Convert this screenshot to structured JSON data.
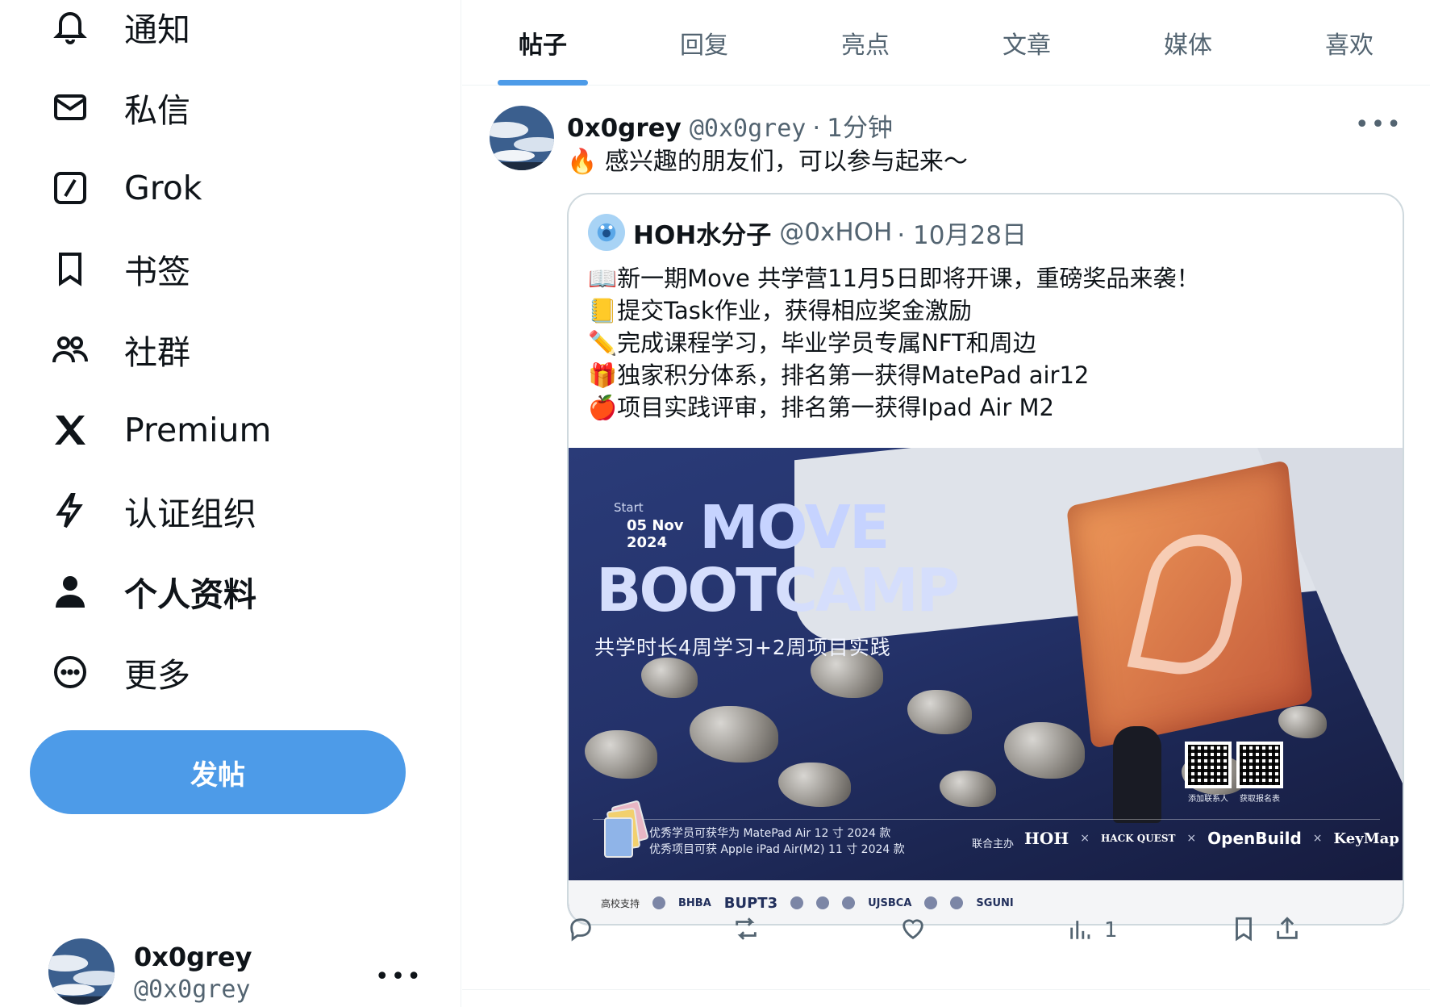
{
  "sidebar": {
    "items": [
      {
        "label": "通知",
        "icon": "bell-icon"
      },
      {
        "label": "私信",
        "icon": "mail-icon"
      },
      {
        "label": "Grok",
        "icon": "grok-icon"
      },
      {
        "label": "书签",
        "icon": "bookmark-icon"
      },
      {
        "label": "社群",
        "icon": "communities-icon"
      },
      {
        "label": "Premium",
        "icon": "x-logo-icon"
      },
      {
        "label": "认证组织",
        "icon": "lightning-icon"
      },
      {
        "label": "个人资料",
        "icon": "person-icon"
      },
      {
        "label": "更多",
        "icon": "more-circle-icon"
      }
    ],
    "post_button": "发帖",
    "account": {
      "name": "0x0grey",
      "handle": "@0x0grey",
      "more": "•••"
    }
  },
  "tabs": [
    {
      "label": "帖子",
      "active": true
    },
    {
      "label": "回复"
    },
    {
      "label": "亮点"
    },
    {
      "label": "文章"
    },
    {
      "label": "媒体"
    },
    {
      "label": "喜欢"
    }
  ],
  "tweet": {
    "author": "0x0grey",
    "handle": "@0x0grey",
    "separator": "·",
    "time": "1分钟",
    "more": "•••",
    "text": "🔥 感兴趣的朋友们，可以参与起来～",
    "quote": {
      "author": "HOH水分子",
      "handle": "@0xHOH",
      "date": "· 10月28日",
      "lines": [
        "📖新一期Move 共学营11月5日即将开课，重磅奖品来袭！",
        "📒提交Task作业，获得相应奖金激励",
        "✏️完成课程学习，毕业学员专属NFT和周边",
        "🎁独家积分体系，排名第一获得MatePad air12",
        "🍎项目实践评审，排名第一获得Ipad Air M2"
      ],
      "poster": {
        "start": "Start",
        "date": "05 Nov\n2024",
        "title_line1": "MOVE",
        "title_line2": "BOOTCAMP",
        "subtitle": "共学时长4周学习+2周项目实践",
        "qr_caption_1": "添加联系人",
        "qr_caption_2": "获取报名表",
        "prize_1": "优秀学员可获华为 MatePad Air 12 寸 2024 款",
        "prize_2": "优秀项目可获 Apple iPad Air(M2) 11 寸 2024 款",
        "sponsor_label": "联合主办",
        "sponsors": [
          "HOH",
          "HACK QUEST",
          "OpenBuild",
          "KeyMap"
        ],
        "support_label": "高校支持",
        "schools": [
          "BHBA",
          "BUPT3",
          "UJSBCA",
          "SGUNI"
        ]
      }
    },
    "actions": {
      "reply": "",
      "repost": "",
      "like": "",
      "views": "1",
      "bookmark": "",
      "share": ""
    }
  },
  "colors": {
    "accent": "#4d9be8",
    "text_primary": "#0f1419",
    "text_secondary": "#536471",
    "border": "#eff3f4"
  }
}
